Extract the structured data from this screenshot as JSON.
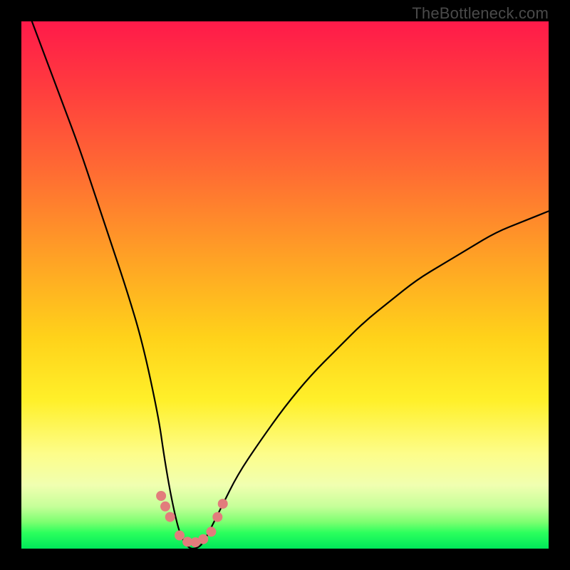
{
  "watermark": "TheBottleneck.com",
  "colors": {
    "frame": "#000000",
    "gradient_top": "#ff1a4a",
    "gradient_bottom": "#00e85a",
    "curve": "#000000",
    "marker": "#e27c7c"
  },
  "chart_data": {
    "type": "line",
    "title": "",
    "xlabel": "",
    "ylabel": "",
    "xlim": [
      0,
      100
    ],
    "ylim": [
      0,
      100
    ],
    "series": [
      {
        "name": "bottleneck-curve",
        "x": [
          2,
          5,
          8,
          11,
          14,
          17,
          20,
          23,
          26,
          27,
          28,
          29,
          30,
          31,
          32,
          33,
          34,
          35,
          36,
          38,
          41,
          45,
          50,
          55,
          60,
          65,
          70,
          75,
          80,
          85,
          90,
          95,
          100
        ],
        "y": [
          100,
          92,
          84,
          76,
          67,
          58,
          49,
          39,
          25,
          18,
          12,
          7,
          3,
          1,
          0,
          0,
          0.5,
          2,
          4,
          8,
          14,
          20,
          27,
          33,
          38,
          43,
          47,
          51,
          54,
          57,
          60,
          62,
          64
        ]
      }
    ],
    "markers": {
      "name": "highlight-points",
      "x": [
        26.5,
        27.3,
        28.2,
        30,
        31.5,
        33,
        34.5,
        36,
        37.2,
        38.2
      ],
      "y": [
        10,
        8,
        6,
        2.5,
        1.3,
        1.2,
        1.8,
        3.2,
        6,
        8.5
      ]
    }
  }
}
